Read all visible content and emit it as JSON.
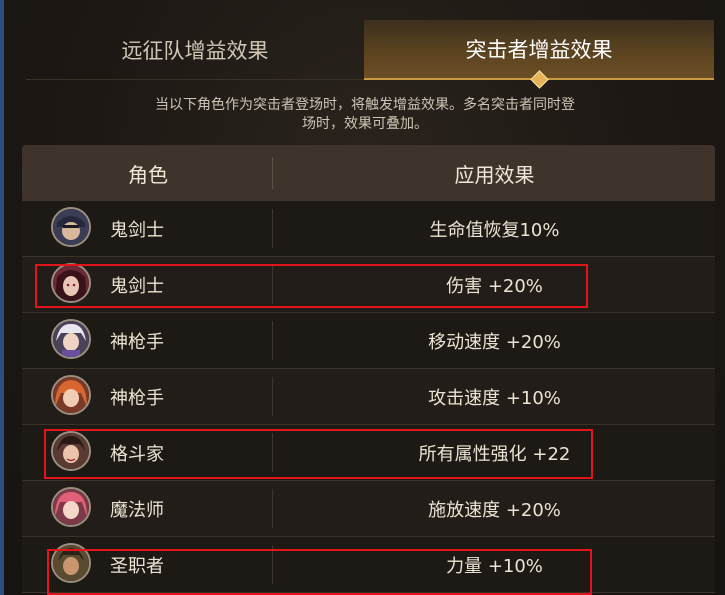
{
  "tabs": [
    {
      "label": "远征队增益效果",
      "active": false
    },
    {
      "label": "突击者增益效果",
      "active": true
    }
  ],
  "description": "当以下角色作为突击者登场时，将触发增益效果。多名突击者同时登场时，效果可叠加。",
  "table": {
    "headers": {
      "role": "角色",
      "effect": "应用效果"
    },
    "rows": [
      {
        "role": "鬼剑士",
        "effect": "生命值恢复10%",
        "highlighted": false
      },
      {
        "role": "鬼剑士",
        "effect": "伤害 +20%",
        "highlighted": true
      },
      {
        "role": "神枪手",
        "effect": "移动速度 +20%",
        "highlighted": false
      },
      {
        "role": "神枪手",
        "effect": "攻击速度 +10%",
        "highlighted": false
      },
      {
        "role": "格斗家",
        "effect": "所有属性强化 +22",
        "highlighted": true
      },
      {
        "role": "魔法师",
        "effect": "施放速度 +20%",
        "highlighted": false
      },
      {
        "role": "圣职者",
        "effect": "力量 +10%",
        "highlighted": true
      }
    ]
  },
  "colors": {
    "highlight": "#e4141b",
    "accent": "#c99a43",
    "text": "#ece3d2"
  }
}
